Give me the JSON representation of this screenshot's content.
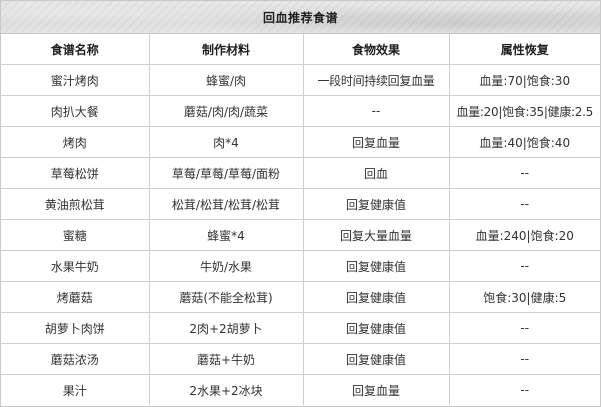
{
  "title": "回血推荐食谱",
  "columns": [
    "食谱名称",
    "制作材料",
    "食物效果",
    "属性恢复"
  ],
  "rows": [
    [
      "蜜汁烤肉",
      "蜂蜜/肉",
      "一段时间持续回复血量",
      "血量:70|饱食:30"
    ],
    [
      "肉扒大餐",
      "蘑菇/肉/肉/蔬菜",
      "--",
      "血量:20|饱食:35|健康:2.5"
    ],
    [
      "烤肉",
      "肉*4",
      "回复血量",
      "血量:40|饱食:40"
    ],
    [
      "草莓松饼",
      "草莓/草莓/草莓/面粉",
      "回血",
      "--"
    ],
    [
      "黄油煎松茸",
      "松茸/松茸/松茸/松茸",
      "回复健康值",
      "--"
    ],
    [
      "蜜糖",
      "蜂蜜*4",
      "回复大量血量",
      "血量:240|饱食:20"
    ],
    [
      "水果牛奶",
      "牛奶/水果",
      "回复健康值",
      "--"
    ],
    [
      "烤蘑菇",
      "蘑菇(不能全松茸)",
      "回复健康值",
      "饱食:30|健康:5"
    ],
    [
      "胡萝卜肉饼",
      "2肉+2胡萝卜",
      "回复健康值",
      "--"
    ],
    [
      "蘑菇浓汤",
      "蘑菇+牛奶",
      "回复健康值",
      "--"
    ],
    [
      "果汁",
      "2水果+2冰块",
      "回复血量",
      "--"
    ]
  ]
}
